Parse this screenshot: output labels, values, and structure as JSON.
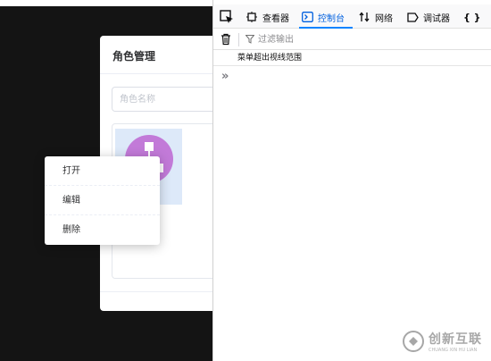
{
  "dialog": {
    "title": "角色管理",
    "search_placeholder": "角色名称"
  },
  "context_menu": {
    "items": [
      {
        "label": "打开"
      },
      {
        "label": "编辑"
      },
      {
        "label": "删除"
      }
    ]
  },
  "devtools": {
    "tabs": [
      {
        "label": "查看器",
        "icon": "inspector-icon"
      },
      {
        "label": "控制台",
        "icon": "console-icon",
        "active": true
      },
      {
        "label": "网络",
        "icon": "network-icon"
      },
      {
        "label": "调试器",
        "icon": "debugger-icon"
      },
      {
        "label": "{ }",
        "icon": "style-editor-icon"
      }
    ],
    "filter_placeholder": "过滤输出",
    "console_log": "菜单超出视线范围",
    "prompt": "»",
    "accent_color": "#0a84ff"
  },
  "watermark": {
    "title": "创新互联",
    "subtitle": "CHUANG XIN HU LIAN"
  }
}
